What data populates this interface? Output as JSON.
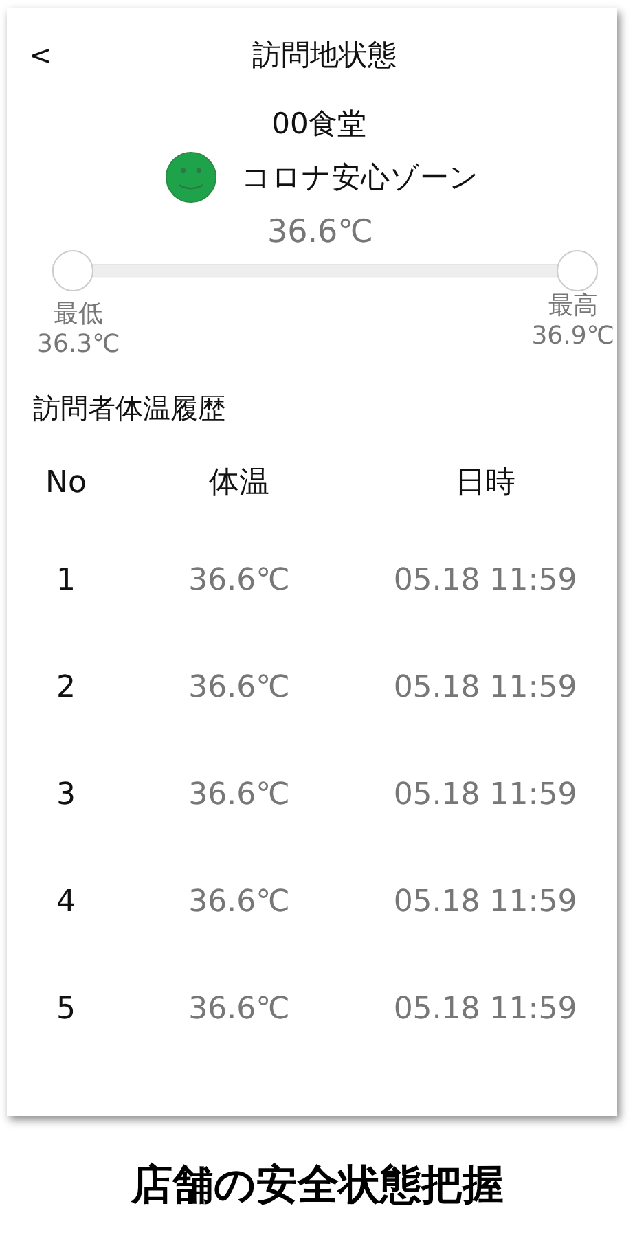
{
  "header": {
    "back": "<",
    "title": "訪問地状態"
  },
  "place": {
    "name": "00食堂",
    "status": "コロナ安心ゾーン",
    "status_icon": {
      "color": "#1fa34a"
    }
  },
  "temperature": {
    "current": "36.6℃",
    "thumbs": [
      {
        "level": 0
      },
      {
        "level": 1
      }
    ],
    "min_label": "最低",
    "min_value": "36.3℃",
    "max_label": "最高",
    "max_value": "36.9℃"
  },
  "history": {
    "title": "訪問者体温履歴",
    "columns": [
      "No",
      "体温",
      "日時"
    ],
    "rows": [
      {
        "no": "1",
        "temp": "36.6℃",
        "time": "05.18 11:59"
      },
      {
        "no": "2",
        "temp": "36.6℃",
        "time": "05.18 11:59"
      },
      {
        "no": "3",
        "temp": "36.6℃",
        "time": "05.18 11:59"
      },
      {
        "no": "4",
        "temp": "36.6℃",
        "time": "05.18 11:59"
      },
      {
        "no": "5",
        "temp": "36.6℃",
        "time": "05.18 11:59"
      }
    ]
  },
  "caption": "店舗の安全状態把握"
}
